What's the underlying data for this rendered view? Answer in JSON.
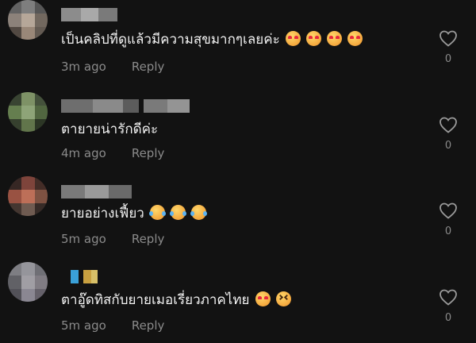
{
  "comments": [
    {
      "text": "เป็นคลิปที่ดูแล้วมีความสุขมากๆเลยค่ะ",
      "emojis": [
        "heart-eyes",
        "heart-eyes",
        "heart-eyes",
        "heart-eyes"
      ],
      "time": "3m ago",
      "reply": "Reply",
      "likes": "0"
    },
    {
      "text": "ตายายน่ารักดีค่ะ",
      "emojis": [],
      "time": "4m ago",
      "reply": "Reply",
      "likes": "0"
    },
    {
      "text": "ยายอย่างเฟี้ยว",
      "emojis": [
        "tears",
        "tears",
        "tears"
      ],
      "time": "5m ago",
      "reply": "Reply",
      "likes": "0"
    },
    {
      "text": "ตาอู๊ดทิสกับยายเมอเรี่ยวภาคไทย",
      "emojis": [
        "heart-eyes",
        "squint"
      ],
      "time": "5m ago",
      "reply": "Reply",
      "likes": "0"
    }
  ],
  "colors": {
    "background": "#121212",
    "text": "#f2f2f2",
    "muted": "#8a8a8a"
  }
}
